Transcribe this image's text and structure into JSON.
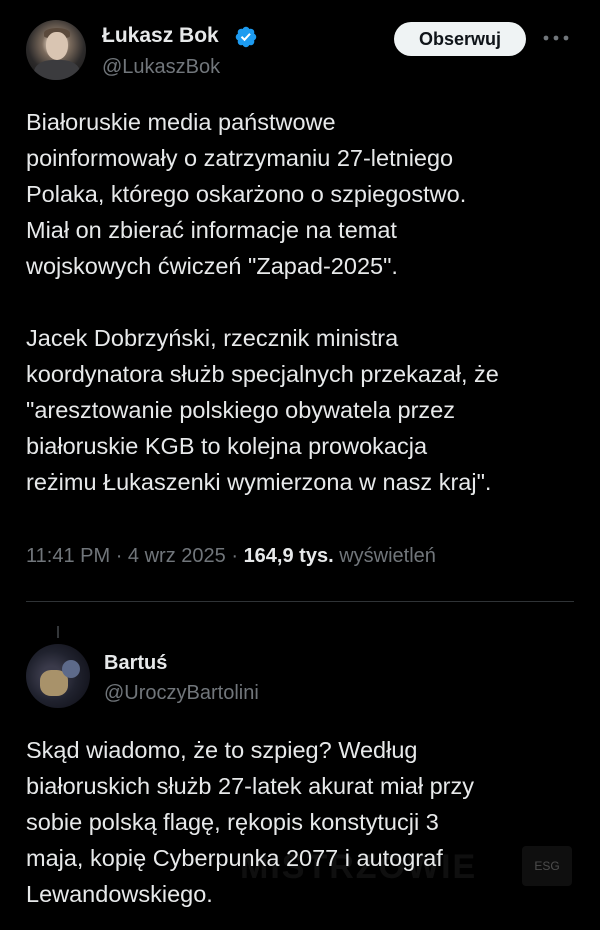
{
  "main_tweet": {
    "author_name": "Łukasz Bok",
    "author_handle": "@LukaszBok",
    "verified": true,
    "follow_label": "Obserwuj",
    "text": "Białoruskie media państwowe\npoinformowały o zatrzymaniu 27-letniego\nPolaka, którego oskarżono o szpiegostwo.\nMiał on zbierać informacje na temat\nwojskowych ćwiczeń \"Zapad-2025\".\n\nJacek Dobrzyński, rzecznik ministra\nkoordynatora służb specjalnych przekazał, że\n\"aresztowanie polskiego obywatela przez\nbiałoruskie KGB to kolejna prowokacja\nreżimu Łukaszenki wymierzona w nasz kraj\".",
    "time": "11:41 PM",
    "separator": "·",
    "date": "4 wrz 2025",
    "views_count": "164,9 tys.",
    "views_label": "wyświetleń"
  },
  "reply_tweet": {
    "author_name": "Bartuś",
    "author_handle": "@UroczyBartolini",
    "text": "Skąd wiadomo, że to szpieg? Według\nbiałoruskich służb 27-latek akurat miał przy\nsobie polską flagę, rękopis konstytucji 3\nmaja, kopię Cyberpunka 2077 i autograf\nLewandowskiego.",
    "watermark": "MISTRZOWIE",
    "watermark_badge": "ESG"
  },
  "colors": {
    "background": "#000000",
    "text_primary": "#e7e9ea",
    "text_secondary": "#71767b",
    "verified_blue": "#1d9bf0",
    "divider": "#2f3336"
  },
  "icons": {
    "verified": "verified-badge-icon",
    "more": "more-options-icon"
  }
}
